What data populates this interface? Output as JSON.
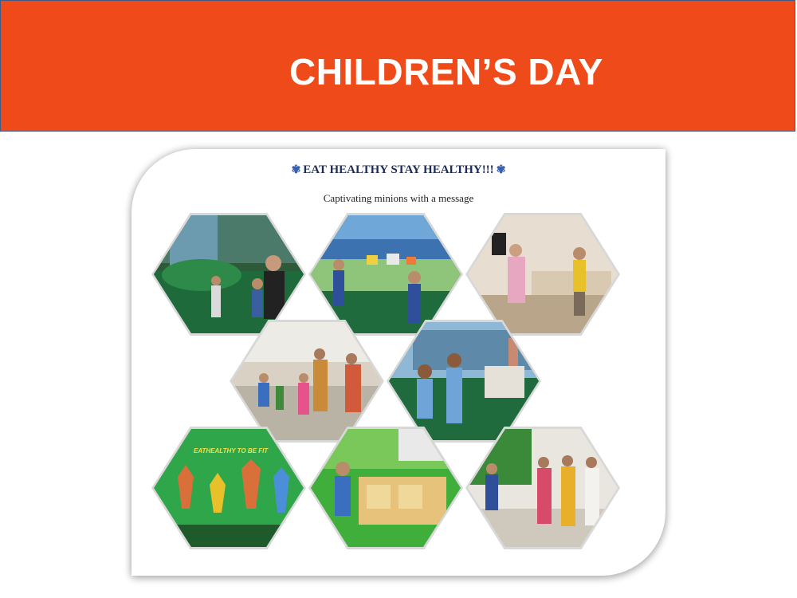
{
  "slide": {
    "title": "CHILDREN’S DAY"
  },
  "card": {
    "heading": "EAT HEALTHY  STAY HEALTHY!!!",
    "ornament": "✾",
    "subheading": "Captivating minions with a message"
  },
  "photos": {
    "sign_text": "EATHEALTHY TO BE FIT"
  },
  "colors": {
    "banner": "#ef4b1a",
    "banner_border": "#3f5a86",
    "title_text": "#ffffff",
    "heading_text": "#1d2b55"
  }
}
